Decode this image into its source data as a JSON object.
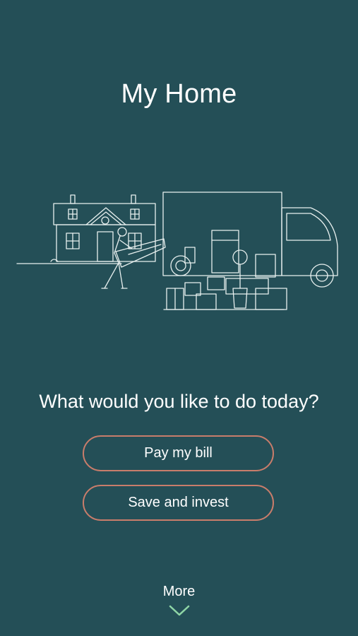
{
  "header": {
    "title": "My Home"
  },
  "illustration": {
    "name": "moving-house-illustration"
  },
  "prompt": {
    "question": "What would you like to do today?"
  },
  "actions": {
    "pay_bill_label": "Pay my bill",
    "save_invest_label": "Save and invest"
  },
  "footer": {
    "more_label": "More",
    "more_icon": "chevron-down-icon"
  },
  "colors": {
    "background": "#244f57",
    "button_border": "#c97d6b",
    "chevron": "#8fd6a6",
    "text": "#ffffff"
  }
}
